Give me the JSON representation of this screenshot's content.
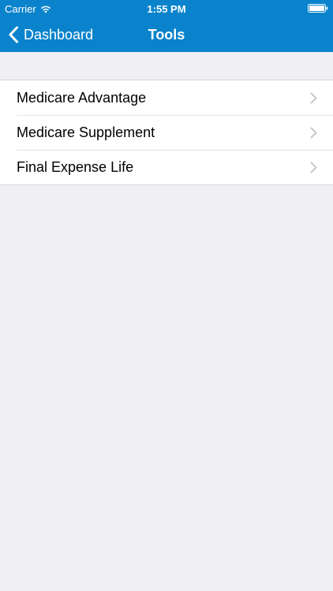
{
  "status_bar": {
    "carrier": "Carrier",
    "time": "1:55 PM",
    "wifi_icon": "wifi-icon",
    "battery_icon": "battery-icon"
  },
  "nav": {
    "back_label": "Dashboard",
    "back_icon": "chevron-left-icon",
    "title": "Tools"
  },
  "list": {
    "items": [
      {
        "label": "Medicare Advantage",
        "icon": "chevron-right-icon"
      },
      {
        "label": "Medicare Supplement",
        "icon": "chevron-right-icon"
      },
      {
        "label": "Final Expense Life",
        "icon": "chevron-right-icon"
      }
    ]
  },
  "colors": {
    "header": "#0a83cc",
    "background": "#efeff4",
    "cell": "#ffffff",
    "chevron": "#c7c7cc"
  }
}
